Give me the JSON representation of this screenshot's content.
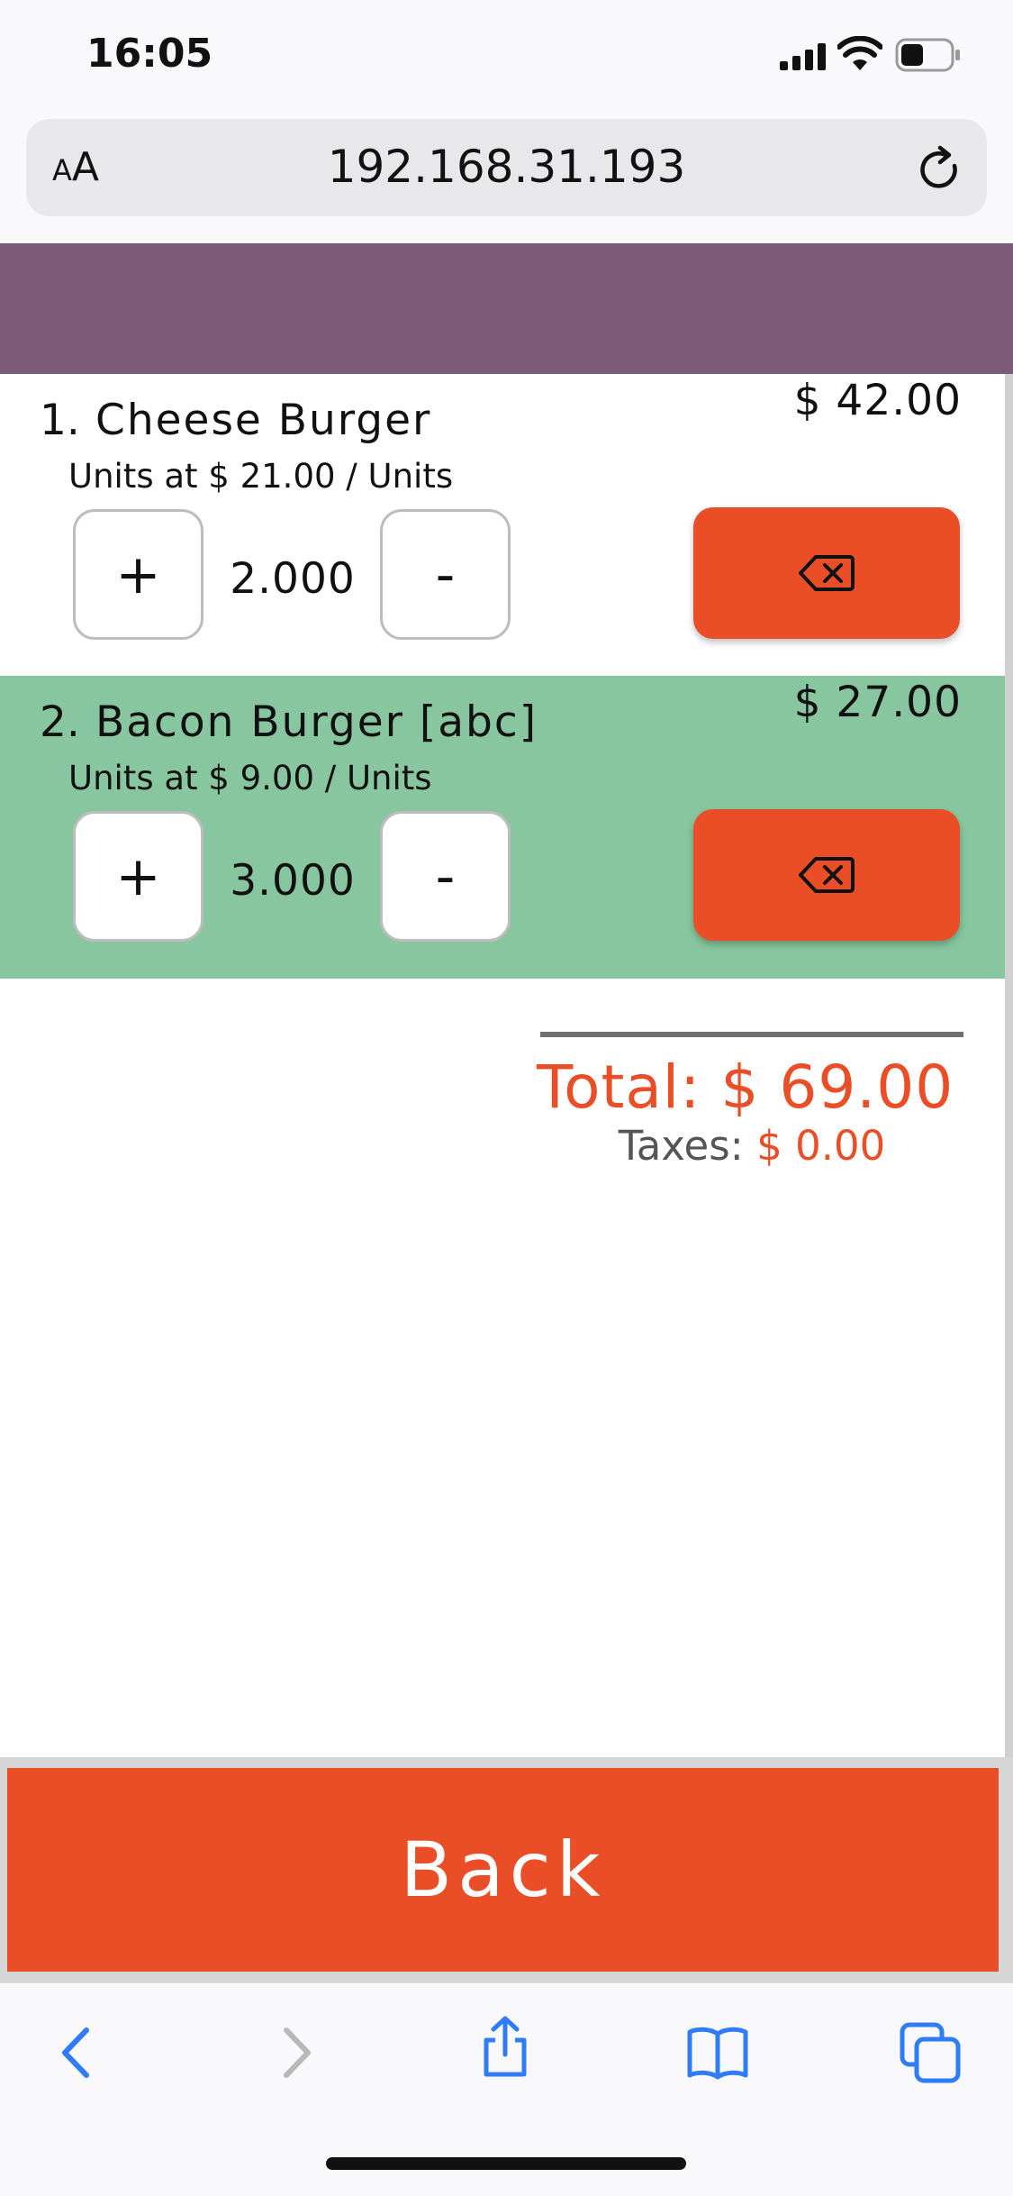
{
  "status_bar": {
    "time": "16:05"
  },
  "browser": {
    "text_size_label_small": "A",
    "text_size_label_large": "A",
    "url": "192.168.31.193"
  },
  "order_lines": [
    {
      "index": "1.",
      "name": "Cheese Burger",
      "price": "$ 42.00",
      "unit_info": "Units at $ 21.00 / Units",
      "quantity": "2.000",
      "plus_label": "+",
      "minus_label": "-"
    },
    {
      "index": "2.",
      "name": "Bacon Burger [abc]",
      "price": "$ 27.00",
      "unit_info": "Units at $ 9.00 / Units",
      "quantity": "3.000",
      "plus_label": "+",
      "minus_label": "-"
    }
  ],
  "summary": {
    "total": "Total: $ 69.00",
    "taxes_label": "Taxes:",
    "taxes_value": "$ 0.00"
  },
  "actions": {
    "back_label": "Back"
  },
  "colors": {
    "accent": "#e94e26",
    "header": "#7d5b78",
    "selected_row": "#87c69e"
  },
  "icons": [
    "signal-icon",
    "wifi-icon",
    "battery-icon",
    "reload-icon",
    "delete-backspace-icon",
    "back-arrow-icon",
    "forward-arrow-icon",
    "share-icon",
    "bookmarks-icon",
    "tabs-icon"
  ]
}
